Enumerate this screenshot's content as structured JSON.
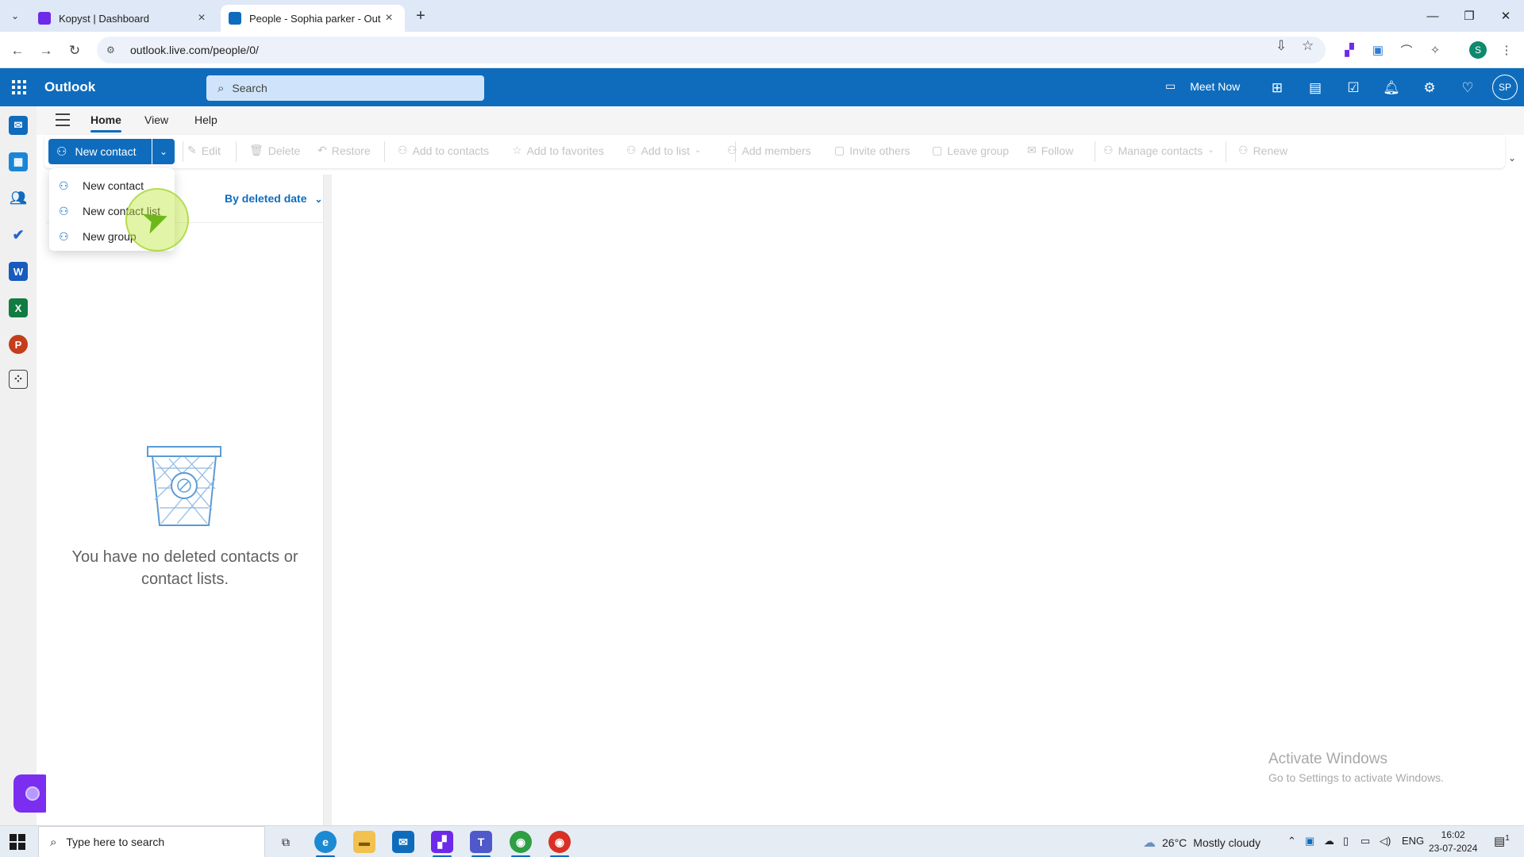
{
  "browser": {
    "tabs": [
      {
        "title": "Kopyst | Dashboard",
        "favicon_color": "#6d2ae8"
      },
      {
        "title": "People - Sophia parker - Outlook",
        "favicon_color": "#0f6cbd"
      }
    ],
    "url": "outlook.live.com/people/0/",
    "profile_initial": "S",
    "window_controls": {
      "minimize": "—",
      "restore": "❐",
      "close": "✕"
    }
  },
  "outlook": {
    "brand": "Outlook",
    "search_placeholder": "Search",
    "meet_now": "Meet Now",
    "avatar_initials": "SP",
    "accent_color": "#0f6cbd"
  },
  "ribbon": {
    "tabs": [
      "Home",
      "View",
      "Help"
    ],
    "new_contact": "New contact",
    "buttons": [
      "Edit",
      "Delete",
      "Restore",
      "Add to contacts",
      "Add to favorites",
      "Add to list",
      "Add members",
      "Invite others",
      "Leave group",
      "Follow",
      "Manage contacts",
      "Renew"
    ]
  },
  "dropdown": {
    "items": [
      "New contact",
      "New contact list",
      "New group"
    ]
  },
  "list": {
    "sort_label": "By deleted date",
    "empty_message": "You have no deleted contacts or contact lists."
  },
  "watermark": {
    "line1": "Activate Windows",
    "line2": "Go to Settings to activate Windows."
  },
  "taskbar": {
    "search_placeholder": "Type here to search",
    "weather_temp": "26°C",
    "weather_text": "Mostly cloudy",
    "language": "ENG",
    "time": "16:02",
    "date": "23-07-2024",
    "notification_count": "1"
  }
}
